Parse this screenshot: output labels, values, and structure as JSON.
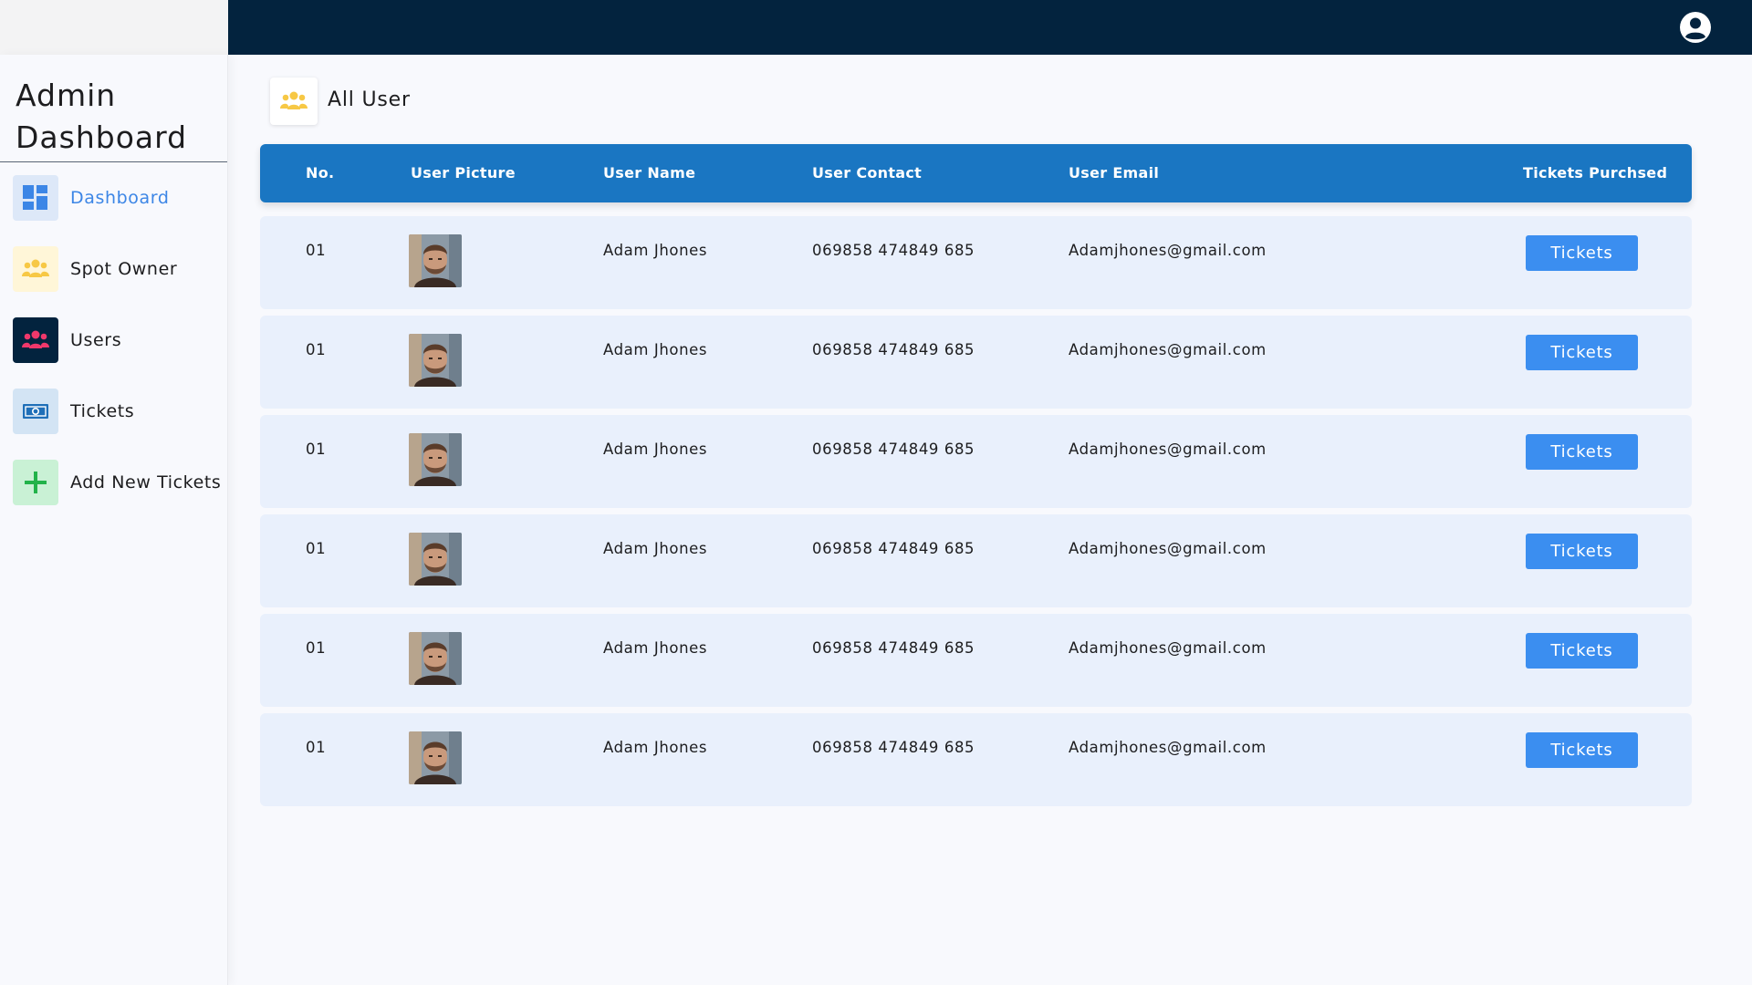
{
  "sidebar": {
    "title_line1": "Admin",
    "title_line2": "Dashboard",
    "items": [
      {
        "label": "Dashboard",
        "icon": "dashboard-grid-icon",
        "active": true
      },
      {
        "label": "Spot Owner",
        "icon": "users-group-icon"
      },
      {
        "label": "Users",
        "icon": "users-group-icon"
      },
      {
        "label": "Tickets",
        "icon": "ticket-money-icon"
      },
      {
        "label": "Add New Tickets",
        "icon": "plus-icon"
      }
    ]
  },
  "header": {
    "profile_icon": "user-circle-icon"
  },
  "section": {
    "title": "All User",
    "icon": "users-group-icon"
  },
  "table": {
    "columns": [
      "No.",
      "User Picture",
      "User Name",
      "User Contact",
      "User Email",
      "Tickets Purchsed"
    ],
    "rows": [
      {
        "no": "01",
        "name": "Adam Jhones",
        "contact": "069858 474849 685",
        "email": "Adamjhones@gmail.com",
        "button": "Tickets"
      },
      {
        "no": "01",
        "name": "Adam Jhones",
        "contact": "069858 474849 685",
        "email": "Adamjhones@gmail.com",
        "button": "Tickets"
      },
      {
        "no": "01",
        "name": "Adam Jhones",
        "contact": "069858 474849 685",
        "email": "Adamjhones@gmail.com",
        "button": "Tickets"
      },
      {
        "no": "01",
        "name": "Adam Jhones",
        "contact": "069858 474849 685",
        "email": "Adamjhones@gmail.com",
        "button": "Tickets"
      },
      {
        "no": "01",
        "name": "Adam Jhones",
        "contact": "069858 474849 685",
        "email": "Adamjhones@gmail.com",
        "button": "Tickets"
      },
      {
        "no": "01",
        "name": "Adam Jhones",
        "contact": "069858 474849 685",
        "email": "Adamjhones@gmail.com",
        "button": "Tickets"
      }
    ]
  },
  "colors": {
    "topbar": "#03233e",
    "table_header": "#1a76c2",
    "row_bg": "#e9f0fc",
    "button": "#3b8ef0",
    "active_nav": "#3c86e6"
  }
}
